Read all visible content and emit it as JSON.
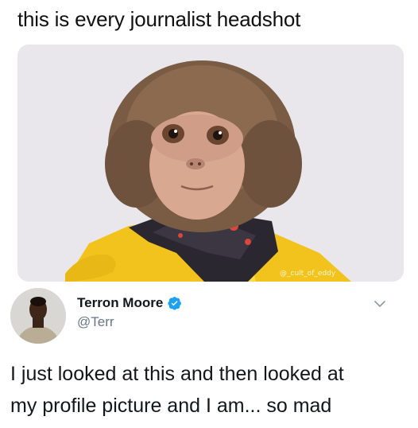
{
  "caption": "this is every journalist headshot",
  "photo": {
    "subject": "monkey wearing yellow kimono",
    "background_color": "#e9e7ec",
    "watermark": "@_cult_of_eddy"
  },
  "tweet": {
    "display_name": "Terron Moore",
    "handle": "@Terr",
    "verified": true,
    "text_lines": [
      "I just looked at this and then looked at",
      "my profile picture and I am... so mad"
    ]
  },
  "icons": {
    "verified": "verified-badge-icon",
    "menu": "chevron-down-icon"
  },
  "colors": {
    "verified_blue": "#1da1f2",
    "handle_gray": "#657786",
    "kimono_yellow": "#f2c21b"
  }
}
